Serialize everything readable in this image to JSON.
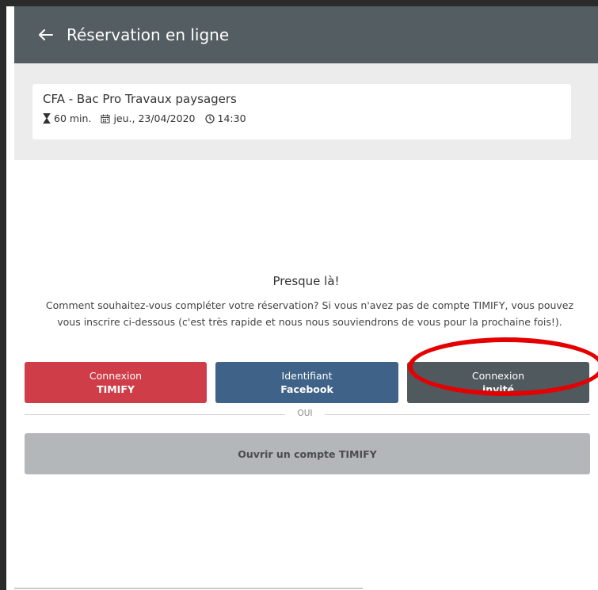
{
  "header": {
    "back_icon": "arrow-left-icon",
    "title": "Réservation en ligne"
  },
  "summary": {
    "service_name": "CFA - Bac Pro Travaux paysagers",
    "duration": "60 min.",
    "duration_icon": "hourglass-icon",
    "date": "jeu., 23/04/2020",
    "date_icon": "calendar-icon",
    "time": "14:30",
    "time_icon": "clock-icon"
  },
  "login": {
    "heading": "Presque là!",
    "description": "Comment souhaitez-vous compléter votre réservation? Si vous n'avez pas de compte TIMIFY, vous pouvez vous inscrire ci-dessous (c'est très rapide et nous nous souviendrons de vous pour la prochaine fois!).",
    "buttons": {
      "timify": {
        "line1": "Connexion",
        "line2": "TIMIFY",
        "color": "#cf3e48"
      },
      "facebook": {
        "line1": "Identifiant",
        "line2": "Facebook",
        "color": "#3f6288"
      },
      "guest": {
        "line1": "Connexion",
        "line2": "invité",
        "color": "#50595e"
      }
    },
    "divider_text": "OUI",
    "register_label": "Ouvrir un compte TIMIFY"
  },
  "colors": {
    "header_bg": "#545d62",
    "highlight": "#e40000"
  }
}
